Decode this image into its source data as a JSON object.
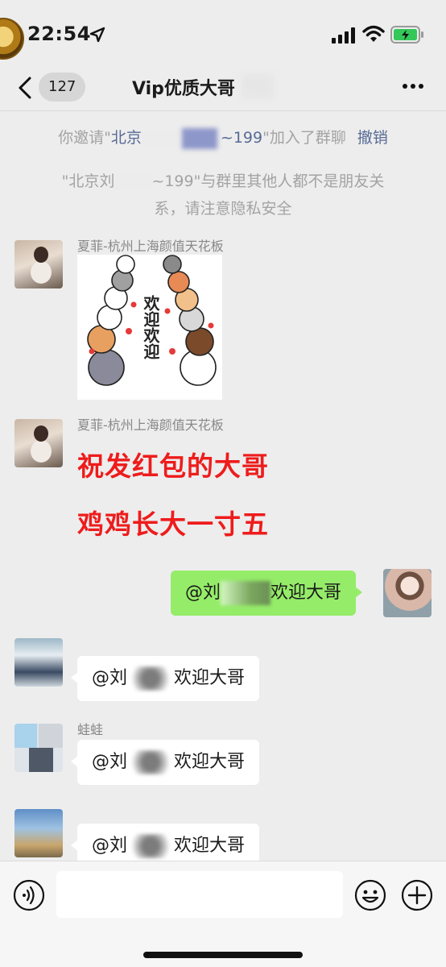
{
  "status_bar": {
    "time": "22:54"
  },
  "nav": {
    "unread_count": "127",
    "title": "Vip优质大哥"
  },
  "system": {
    "invite_prefix": "你邀请\"",
    "invite_name_start": "北京",
    "invite_name_end": "~199",
    "invite_suffix": "\"加入了群聊",
    "undo": "撤销",
    "warning_prefix": "\"北京刘",
    "warning_rest": "~199\"与群里其他人都不是朋友关系，请注意隐私安全"
  },
  "messages": [
    {
      "sender": "夏菲-杭州上海颜值天花板",
      "sticker_text": "欢迎欢迎"
    },
    {
      "sender": "夏菲-杭州上海颜值天花板",
      "lines": [
        "祝发红包的大哥",
        "鸡鸡长大一寸五"
      ]
    },
    {
      "self": true,
      "prefix": "@刘",
      "text": "欢迎大哥"
    },
    {
      "sender": "",
      "prefix": "@刘",
      "text": "欢迎大哥"
    },
    {
      "sender": "蛙蛙",
      "prefix": "@刘",
      "text": "欢迎大哥"
    },
    {
      "sender": "",
      "prefix": "@刘",
      "text": "欢迎大哥"
    }
  ],
  "input": {
    "placeholder": ""
  },
  "colors": {
    "self_bubble": "#95ec69",
    "highlight_text": "#ee1c1c",
    "link": "#576b95",
    "background": "#ededed"
  }
}
